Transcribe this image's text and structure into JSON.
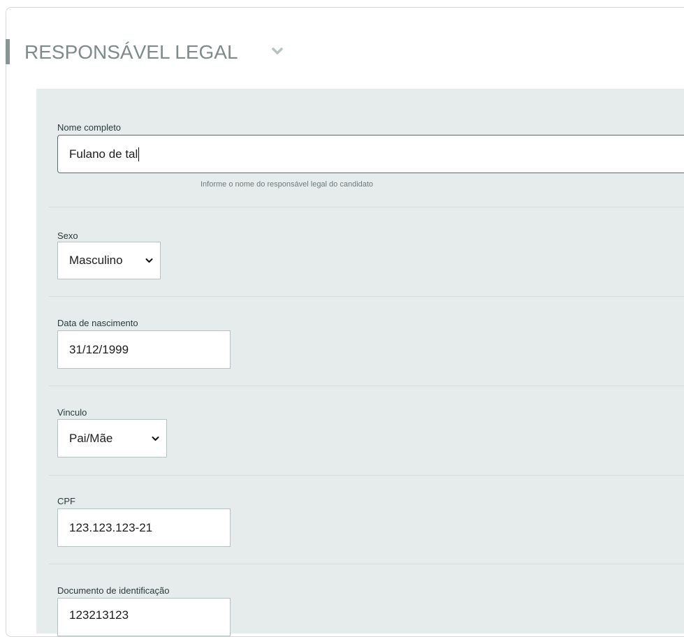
{
  "section": {
    "title": "RESPONSÁVEL LEGAL",
    "toggle_icon": "chevron-down-icon"
  },
  "fields": {
    "nome": {
      "label": "Nome completo",
      "value": "Fulano de tal",
      "help": "Informe o nome do responsável legal do candidato"
    },
    "sexo": {
      "label": "Sexo",
      "value": "Masculino"
    },
    "nascimento": {
      "label": "Data de nascimento",
      "value": "31/12/1999"
    },
    "vinculo": {
      "label": "Vinculo",
      "value": "Pai/Mãe"
    },
    "cpf": {
      "label": "CPF",
      "value": "123.123.123-21"
    },
    "documento": {
      "label": "Documento de identificação",
      "value": "123213123"
    }
  },
  "colors": {
    "panel_bg": "#e6ecec",
    "title": "#7d8b8a",
    "accent_bar": "#8a9494"
  }
}
